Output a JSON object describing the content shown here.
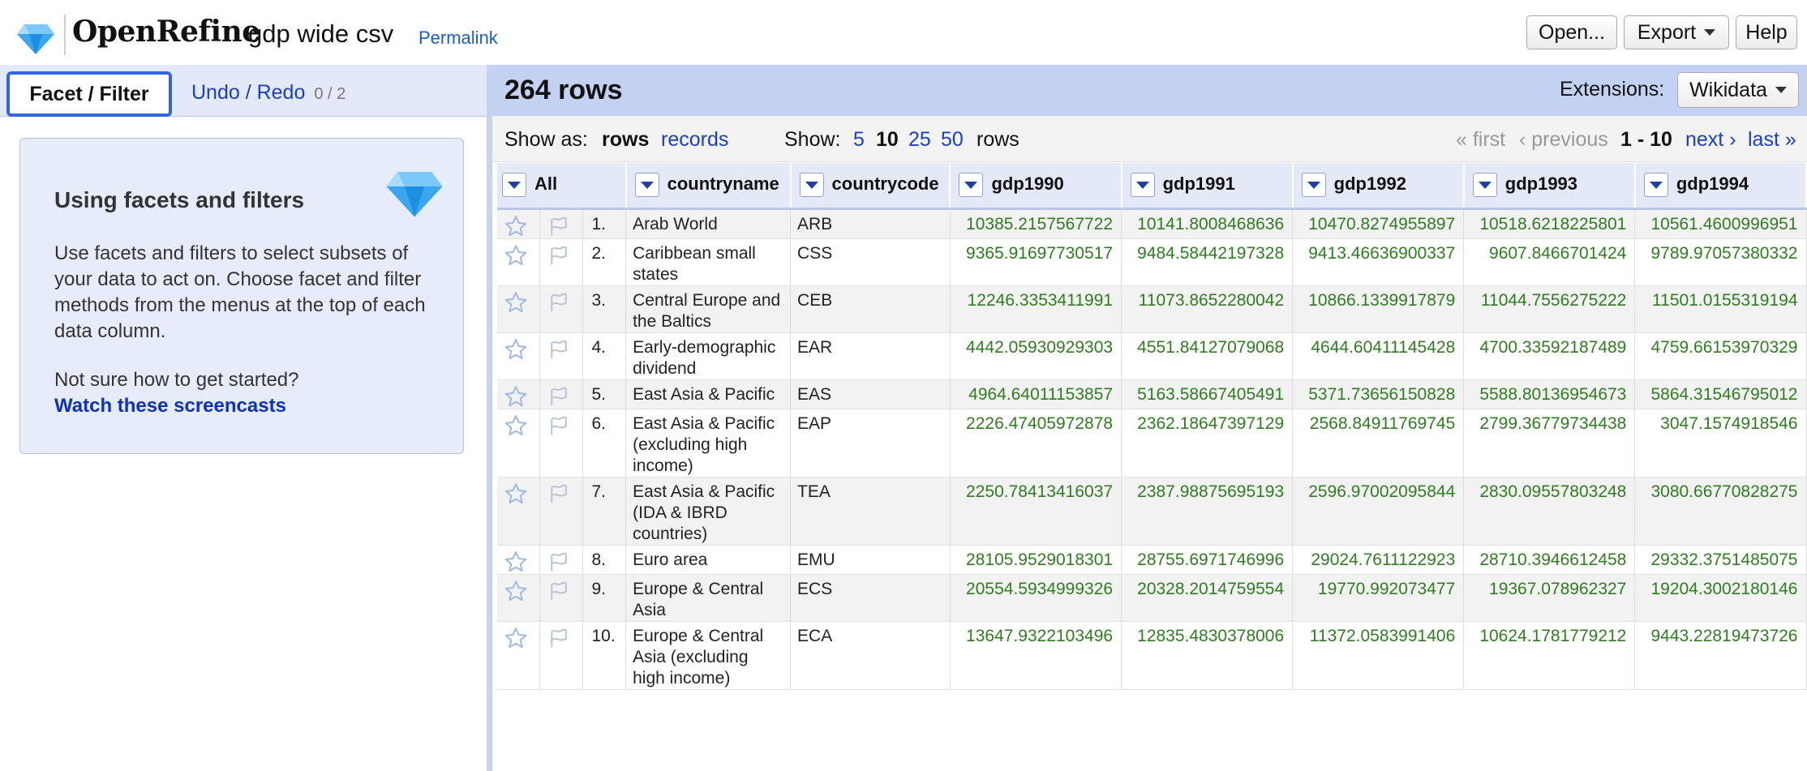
{
  "header": {
    "app_name": "OpenRefine",
    "project_name": "gdp wide csv",
    "permalink": "Permalink",
    "buttons": {
      "open": "Open...",
      "export": "Export",
      "help": "Help"
    }
  },
  "left_panel": {
    "tabs": {
      "facet_filter": "Facet / Filter",
      "undo_redo": "Undo / Redo",
      "undo_count": "0 / 2"
    },
    "help": {
      "title": "Using facets and filters",
      "text": "Use facets and filters to select subsets of your data to act on. Choose facet and filter methods from the menus at the top of each data column.",
      "prompt": "Not sure how to get started?",
      "link": "Watch these screencasts"
    }
  },
  "summary": {
    "row_count": "264 rows",
    "extensions_label": "Extensions:",
    "extensions_button": "Wikidata"
  },
  "view_bar": {
    "show_as_label": "Show as:",
    "rows": "rows",
    "records": "records",
    "show_label": "Show:",
    "page_sizes": [
      "5",
      "10",
      "25",
      "50"
    ],
    "rows_suffix": "rows",
    "first": "« first",
    "previous": "‹ previous",
    "range": "1 - 10",
    "next": "next ›",
    "last": "last »"
  },
  "table": {
    "all_label": "All",
    "columns": [
      "countryname",
      "countrycode",
      "gdp1990",
      "gdp1991",
      "gdp1992",
      "gdp1993",
      "gdp1994"
    ],
    "rows": [
      {
        "index": "1.",
        "cells": [
          "Arab World",
          "ARB",
          "10385.2157567722",
          "10141.8008468636",
          "10470.8274955897",
          "10518.6218225801",
          "10561.4600996951"
        ]
      },
      {
        "index": "2.",
        "cells": [
          "Caribbean small states",
          "CSS",
          "9365.91697730517",
          "9484.58442197328",
          "9413.46636900337",
          "9607.8466701424",
          "9789.97057380332"
        ]
      },
      {
        "index": "3.",
        "cells": [
          "Central Europe and the Baltics",
          "CEB",
          "12246.3353411991",
          "11073.8652280042",
          "10866.1339917879",
          "11044.7556275222",
          "11501.0155319194"
        ]
      },
      {
        "index": "4.",
        "cells": [
          "Early-demographic dividend",
          "EAR",
          "4442.05930929303",
          "4551.84127079068",
          "4644.60411145428",
          "4700.33592187489",
          "4759.66153970329"
        ]
      },
      {
        "index": "5.",
        "cells": [
          "East Asia & Pacific",
          "EAS",
          "4964.64011153857",
          "5163.58667405491",
          "5371.73656150828",
          "5588.80136954673",
          "5864.31546795012"
        ]
      },
      {
        "index": "6.",
        "cells": [
          "East Asia & Pacific (excluding high income)",
          "EAP",
          "2226.47405972878",
          "2362.18647397129",
          "2568.84911769745",
          "2799.36779734438",
          "3047.1574918546"
        ]
      },
      {
        "index": "7.",
        "cells": [
          "East Asia & Pacific (IDA & IBRD countries)",
          "TEA",
          "2250.78413416037",
          "2387.98875695193",
          "2596.97002095844",
          "2830.09557803248",
          "3080.66770828275"
        ]
      },
      {
        "index": "8.",
        "cells": [
          "Euro area",
          "EMU",
          "28105.9529018301",
          "28755.6971746996",
          "29024.7611122923",
          "28710.3946612458",
          "29332.3751485075"
        ]
      },
      {
        "index": "9.",
        "cells": [
          "Europe & Central Asia",
          "ECS",
          "20554.5934999326",
          "20328.2014759554",
          "19770.992073477",
          "19367.078962327",
          "19204.3002180146"
        ]
      },
      {
        "index": "10.",
        "cells": [
          "Europe & Central Asia (excluding high income)",
          "ECA",
          "13647.9322103496",
          "12835.4830378006",
          "11372.0583991406",
          "10624.1781779212",
          "9443.22819473726"
        ]
      }
    ]
  }
}
